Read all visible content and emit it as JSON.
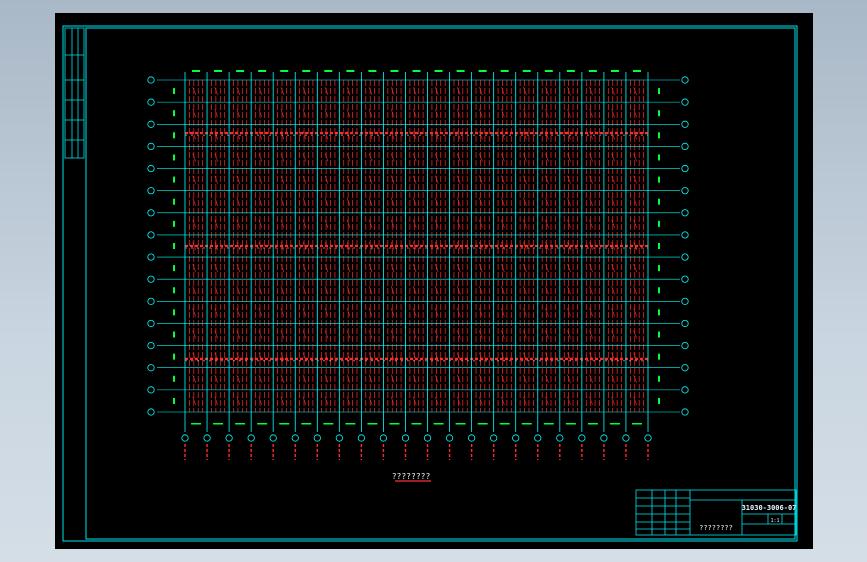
{
  "drawing": {
    "plan_caption": "????????",
    "title_block": {
      "drawing_number": "31030-3006-07",
      "drawing_name": "????????",
      "scale_text": "1:1"
    },
    "colors": {
      "background": "#000000",
      "border": "#00e5ee",
      "grid": "#00ffff",
      "members": "#ff2a2a",
      "dimensions": "#00ff3c",
      "labels": "#ffffff",
      "caption": "#ff3030"
    }
  }
}
